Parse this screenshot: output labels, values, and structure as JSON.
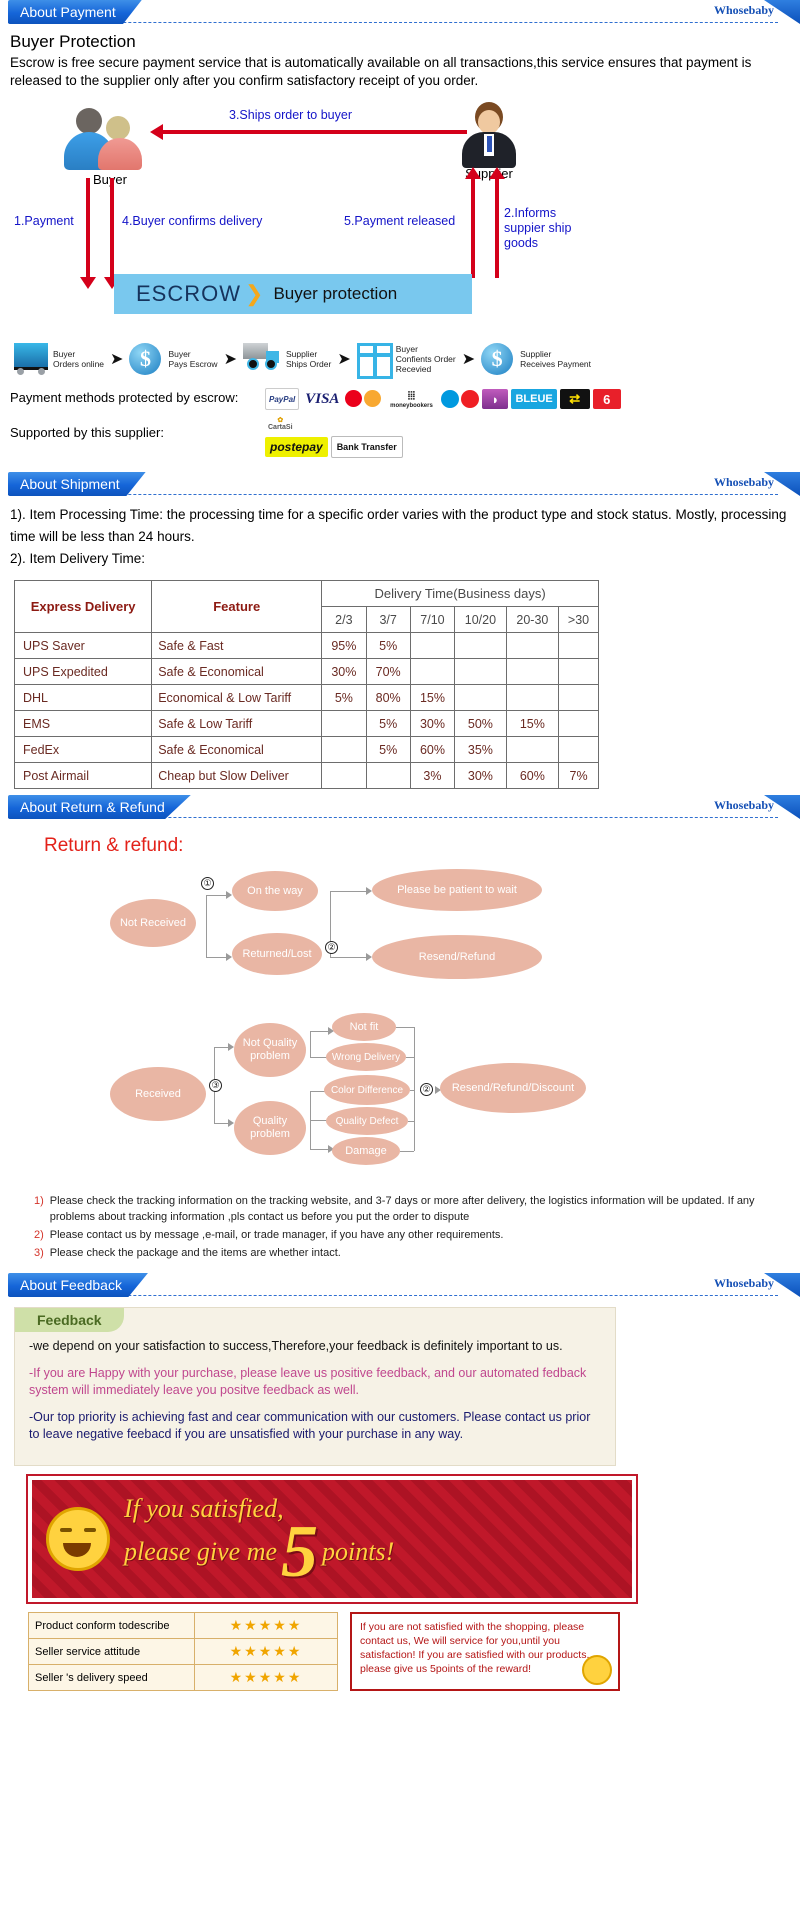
{
  "sections": {
    "payment": {
      "tab": "About Payment",
      "brand": "Whosebaby"
    },
    "shipment": {
      "tab": "About Shipment",
      "brand": "Whosebaby"
    },
    "return": {
      "tab": "About Return & Refund",
      "brand": "Whosebaby"
    },
    "feedback": {
      "tab": "About Feedback",
      "brand": "Whosebaby"
    }
  },
  "payment": {
    "heading": "Buyer Protection",
    "body": "Escrow is free secure payment service that is automatically available on all transactions,this service ensures that payment is released to the supplier only after you confirm satisfactory receipt of you order.",
    "buyer_label": "Buyer",
    "supplier_label": "Supplier",
    "flow": {
      "ships": "3.Ships order to buyer",
      "payment": "1.Payment",
      "confirms": "4.Buyer confirms delivery",
      "released": "5.Payment released",
      "informs": "2.Informs suppier ship goods"
    },
    "escrow_bar": {
      "word": "ESCROW",
      "swoosh": "❯",
      "tagline": "Buyer protection"
    },
    "steps": [
      {
        "icon": "cart-icon",
        "line1": "Buyer",
        "line2": "Orders online"
      },
      {
        "icon": "dollar-coin-icon",
        "line1": "Buyer",
        "line2": "Pays Escrow"
      },
      {
        "icon": "truck-icon",
        "line1": "Supplier",
        "line2": "Ships Order"
      },
      {
        "icon": "gift-box-icon",
        "line1": "Buyer",
        "line2": "Confients Order",
        "line3": "Recevied"
      },
      {
        "icon": "dollar-coin-icon",
        "line1": "Supplier",
        "line2": "Receives Payment"
      }
    ],
    "methods_label": "Payment methods protected by escrow:",
    "supported_label": "Supported by this supplier:",
    "logos_row1": [
      "PayPal",
      "VISA",
      "MasterCard",
      "moneybookers",
      "Maestro",
      "CB",
      "BLEUE",
      "Switch",
      "Solo",
      "CartaSi"
    ],
    "logos_row2": [
      "postepay",
      "Bank Transfer"
    ]
  },
  "shipment": {
    "line1": "1). Item Processing Time: the processing time for a specific order varies with the product type and stock status. Mostly, processing time will be less than 24 hours.",
    "line2": "2). Item Delivery Time:",
    "table": {
      "col_express": "Express Delivery",
      "col_feature": "Feature",
      "col_group": "Delivery Time(Business days)",
      "day_cols": [
        "2/3",
        "3/7",
        "7/10",
        "10/20",
        "20-30",
        ">30"
      ],
      "rows": [
        {
          "name": "UPS Saver",
          "feature": "Safe & Fast",
          "values": [
            "95%",
            "5%",
            "",
            "",
            "",
            ""
          ]
        },
        {
          "name": "UPS Expedited",
          "feature": "Safe & Economical",
          "values": [
            "30%",
            "70%",
            "",
            "",
            "",
            ""
          ]
        },
        {
          "name": "DHL",
          "feature": "Economical & Low Tariff",
          "values": [
            "5%",
            "80%",
            "15%",
            "",
            "",
            ""
          ]
        },
        {
          "name": "EMS",
          "feature": "Safe & Low Tariff",
          "values": [
            "",
            "5%",
            "30%",
            "50%",
            "15%",
            ""
          ]
        },
        {
          "name": "FedEx",
          "feature": "Safe & Economical",
          "values": [
            "",
            "5%",
            "60%",
            "35%",
            "",
            ""
          ]
        },
        {
          "name": "Post Airmail",
          "feature": "Cheap but Slow Deliver",
          "values": [
            "",
            "",
            "3%",
            "30%",
            "60%",
            "7%"
          ]
        }
      ]
    }
  },
  "return": {
    "title": "Return & refund:",
    "flow1": {
      "start": "Not Received",
      "n1": "①",
      "n2": "②",
      "mid_top": "On the way",
      "mid_bottom": "Returned/Lost",
      "end_top": "Please be patient to wait",
      "end_bottom": "Resend/Refund"
    },
    "flow2": {
      "start": "Received",
      "n3": "③",
      "n2": "②",
      "branch_top": "Not Quality problem",
      "branch_bottom": "Quality problem",
      "leaves": [
        "Not fit",
        "Wrong Delivery",
        "Color Difference",
        "Quality Defect",
        "Damage"
      ],
      "end": "Resend/Refund/Discount"
    },
    "notes": [
      {
        "n": "1)",
        "text": "Please check the tracking information on the tracking website, and 3-7 days or more after delivery, the logistics information will be updated. If any problems about tracking information ,pls contact us before you put the order to dispute"
      },
      {
        "n": "2)",
        "text": "Please contact us by message ,e-mail, or trade manager, if you have any other requirements."
      },
      {
        "n": "3)",
        "text": "Please check the package and the items are whether intact."
      }
    ]
  },
  "feedback": {
    "badge": "Feedback",
    "p1": "-we depend on your satisfaction to success,Therefore,your feedback is definitely important to us.",
    "p2": "-If you are Happy with your purchase, please leave us positive feedback, and our automated fedback system will immediately leave you positve feedback as well.",
    "p3": "-Our top priority is achieving fast and cear communication with our customers. Please contact us prior to leave negative feebacd if you are unsatisfied with your purchase in any way.",
    "banner": {
      "line1": "If you satisfied,",
      "line2": "please give me",
      "big": "5",
      "points": "points!"
    },
    "ratings": [
      {
        "label": "Product conform todescribe",
        "stars": "★★★★★"
      },
      {
        "label": "Seller service attitude",
        "stars": "★★★★★"
      },
      {
        "label": "Seller 's delivery speed",
        "stars": "★★★★★"
      }
    ],
    "redbox": "If you are not satisfied with the shopping, please contact us, We will service for you,until you satisfaction! If you are satisfied with our products, please give us 5points of the reward!"
  }
}
